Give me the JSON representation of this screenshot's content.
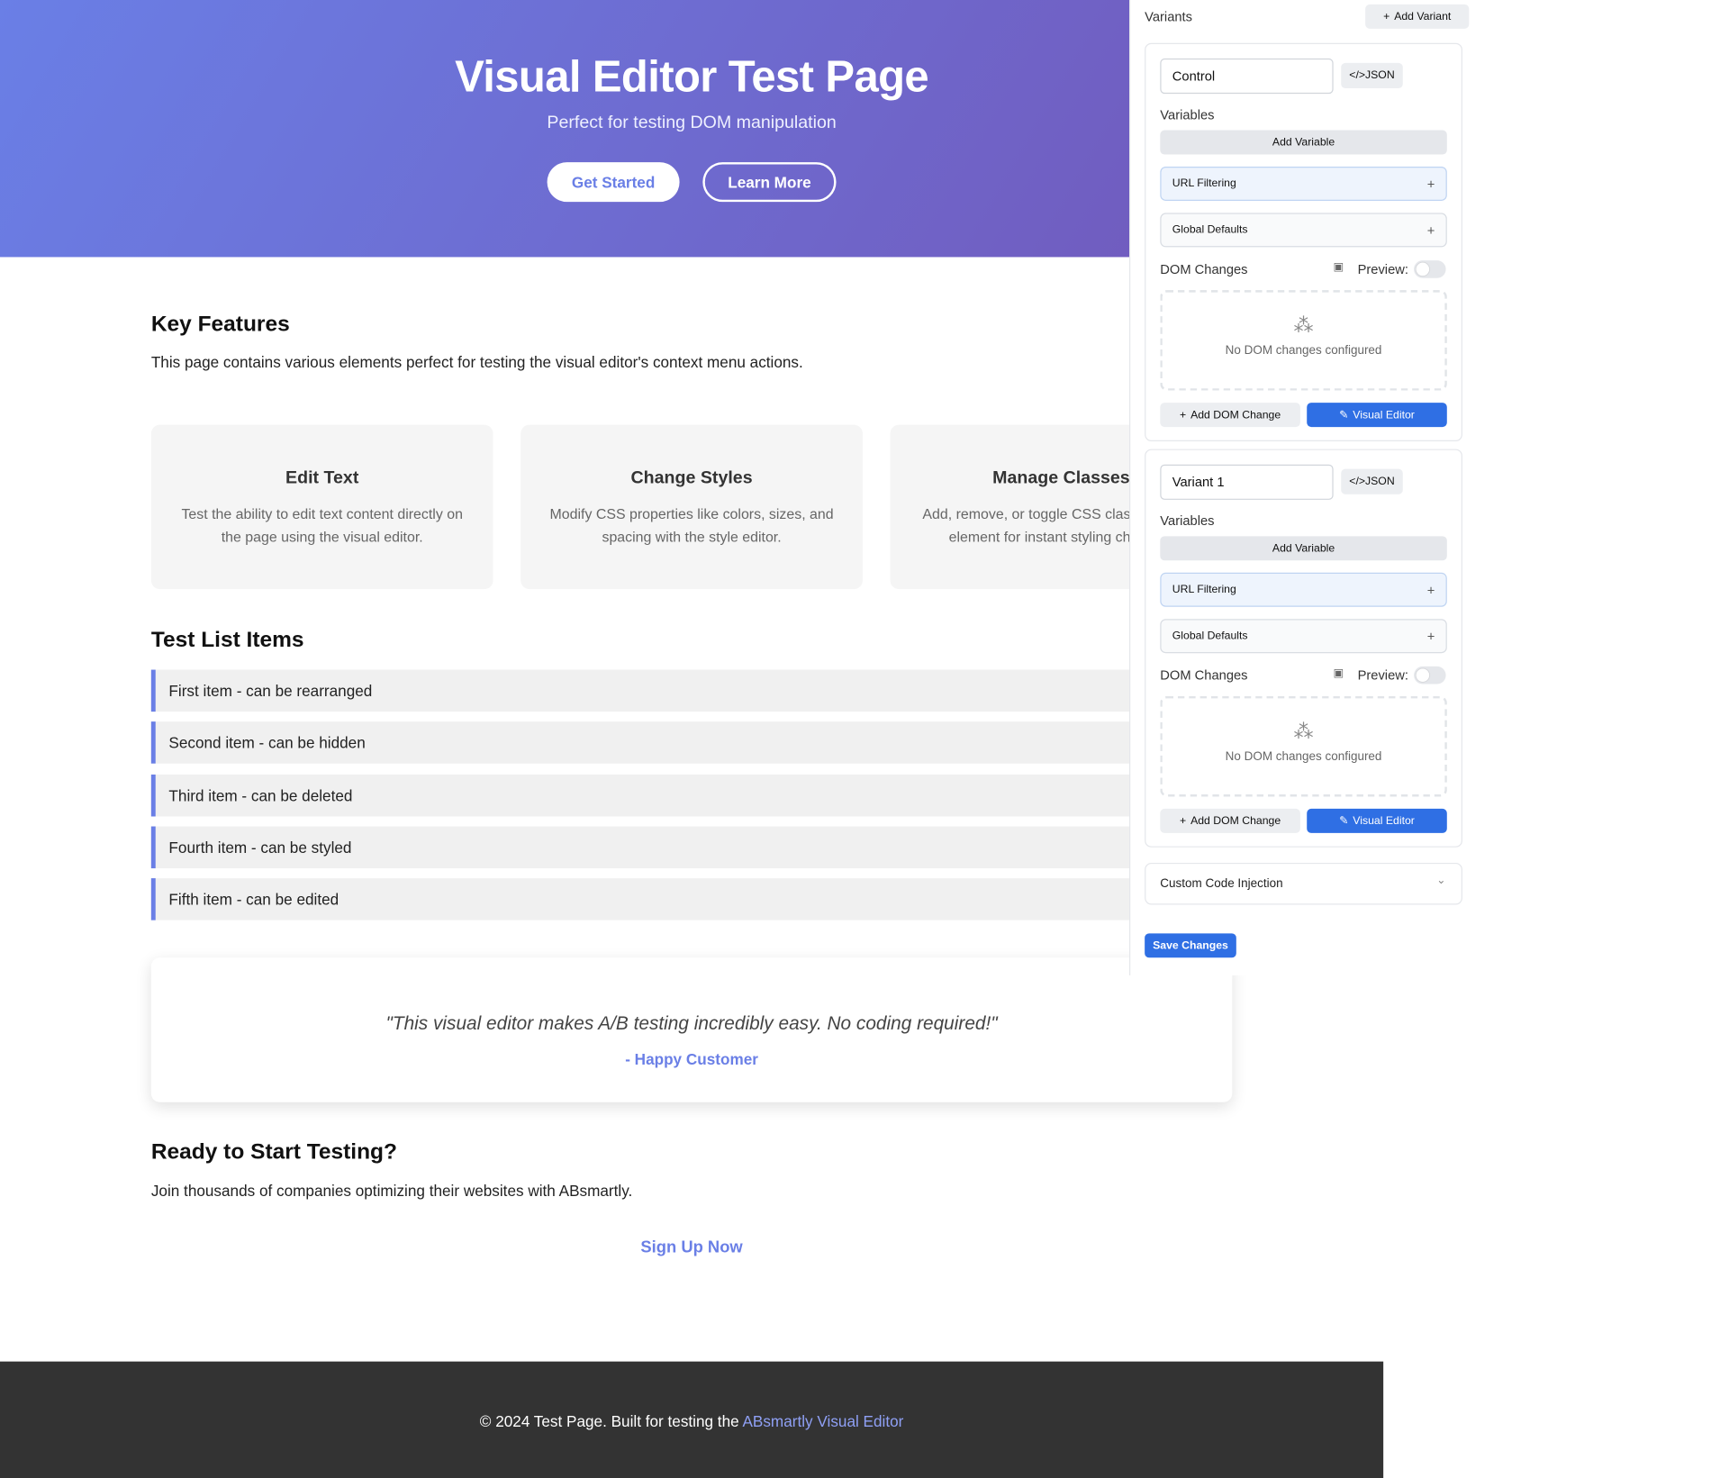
{
  "hero": {
    "title": "Visual Editor Test Page",
    "subtitle": "Perfect for testing DOM manipulation",
    "primary_button": "Get Started",
    "secondary_button": "Learn More"
  },
  "features": {
    "title": "Key Features",
    "description": "This page contains various elements perfect for testing the visual editor's context menu actions.",
    "cards": [
      {
        "title": "Edit Text",
        "text": "Test the ability to edit text content directly on the page using the visual editor."
      },
      {
        "title": "Change Styles",
        "text": "Modify CSS properties like colors, sizes, and spacing with the style editor."
      },
      {
        "title": "Manage Classes",
        "text": "Add, remove, or toggle CSS classes on any element for instant styling changes."
      }
    ]
  },
  "list": {
    "title": "Test List Items",
    "items": [
      "First item - can be rearranged",
      "Second item - can be hidden",
      "Third item - can be deleted",
      "Fourth item - can be styled",
      "Fifth item - can be edited"
    ]
  },
  "testimonial": {
    "quote": "\"This visual editor makes A/B testing incredibly easy. No coding required!\"",
    "author": "- Happy Customer"
  },
  "cta": {
    "title": "Ready to Start Testing?",
    "text": "Join thousands of companies optimizing their websites with ABsmartly.",
    "link": "Sign Up Now"
  },
  "footer": {
    "text": "© 2024 Test Page. Built for testing the",
    "link": "ABsmartly Visual Editor"
  },
  "sidebar": {
    "title": "Variants",
    "add_variant": "Add Variant",
    "variants": [
      {
        "name": "Control",
        "json_label": "JSON",
        "variables_label": "Variables",
        "add_variable": "Add Variable",
        "url_filtering": "URL Filtering",
        "global_defaults": "Global Defaults",
        "dom_changes_label": "DOM Changes",
        "preview_label": "Preview:",
        "empty_text": "No DOM changes configured",
        "add_dom_change": "Add DOM Change",
        "visual_editor": "Visual Editor"
      },
      {
        "name": "Variant 1",
        "json_label": "JSON",
        "variables_label": "Variables",
        "add_variable": "Add Variable",
        "url_filtering": "URL Filtering",
        "global_defaults": "Global Defaults",
        "dom_changes_label": "DOM Changes",
        "preview_label": "Preview:",
        "empty_text": "No DOM changes configured",
        "add_dom_change": "Add DOM Change",
        "visual_editor": "Visual Editor"
      }
    ],
    "custom_code": "Custom Code Injection",
    "save": "Save Changes"
  },
  "colors": {
    "hero_start": "#6a7fe6",
    "hero_end": "#7256b8",
    "accent": "#6a7fe6",
    "primary_blue": "#2f6fe4",
    "footer_bg": "#333333"
  },
  "icons": {
    "plus": "plus-icon",
    "code": "code-icon",
    "clipboard": "clipboard-icon",
    "cursor": "cursor-click-icon",
    "pencil": "pencil-icon",
    "chevron": "chevron-down-icon"
  }
}
